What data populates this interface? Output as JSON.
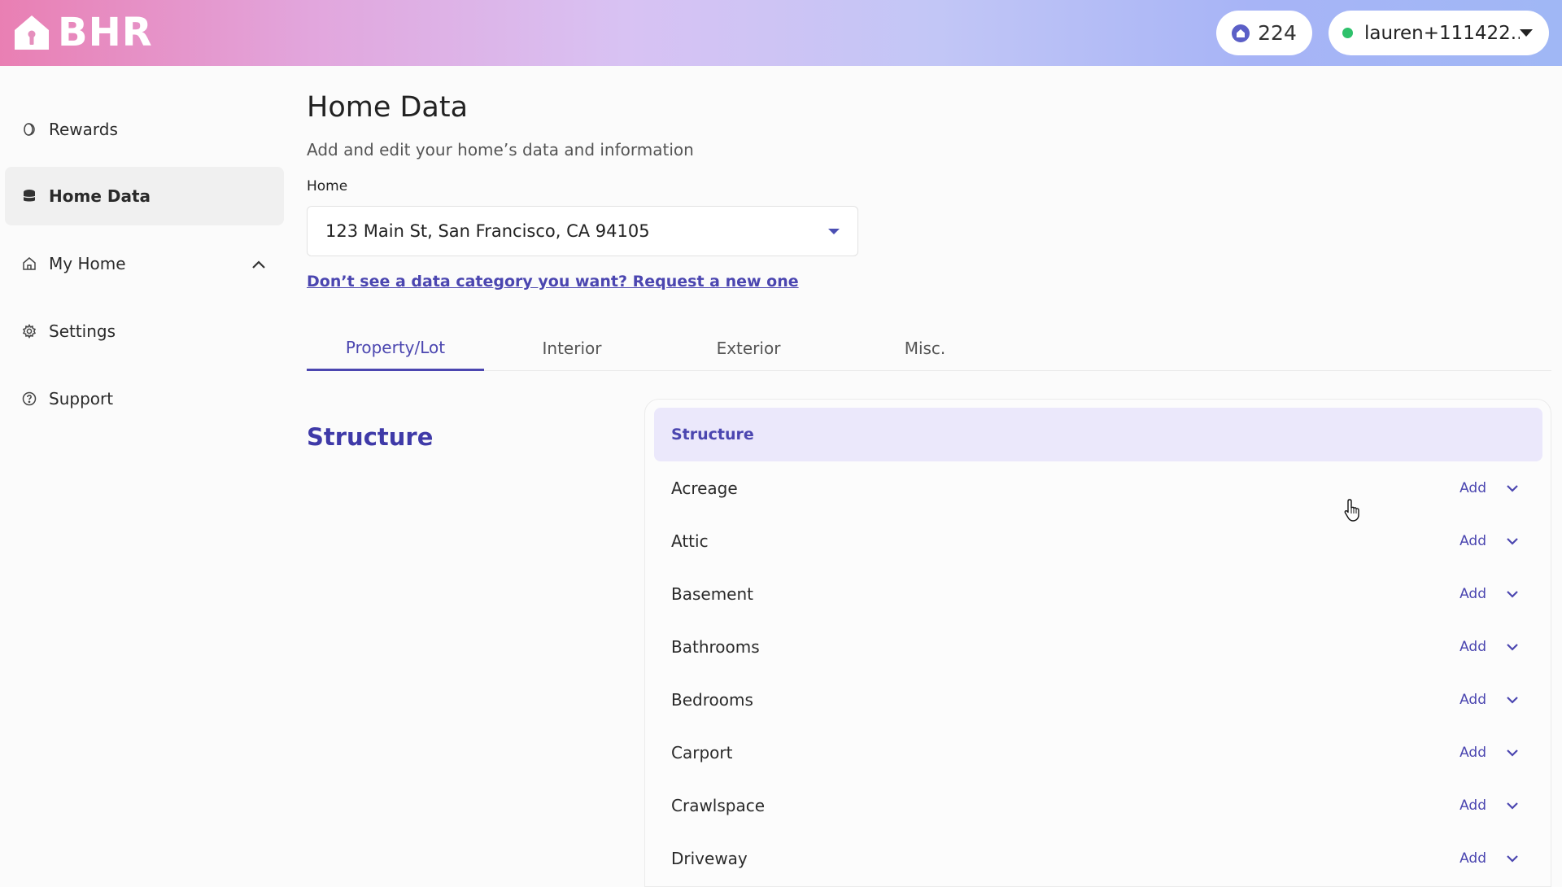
{
  "brand": {
    "name": "BHR"
  },
  "header": {
    "points": "224",
    "user": "lauren+111422..."
  },
  "sidebar": {
    "items": [
      {
        "label": "Rewards",
        "icon": "rewards-icon"
      },
      {
        "label": "Home Data",
        "icon": "database-icon",
        "active": true
      },
      {
        "label": "My Home",
        "icon": "house-icon",
        "expandable": true
      },
      {
        "label": "Settings",
        "icon": "gear-icon"
      },
      {
        "label": "Support",
        "icon": "help-icon"
      }
    ]
  },
  "main": {
    "title": "Home Data",
    "subtitle": "Add and edit your home’s data and information",
    "home_label": "Home",
    "home_value": "123 Main St, San Francisco, CA 94105",
    "request_link": "Don’t see a data category you want? Request a new one",
    "tabs": [
      {
        "label": "Property/Lot",
        "active": true
      },
      {
        "label": "Interior"
      },
      {
        "label": "Exterior"
      },
      {
        "label": "Misc."
      }
    ],
    "section_title": "Structure",
    "panel": {
      "header": "Structure",
      "add_label": "Add",
      "rows": [
        "Acreage",
        "Attic",
        "Basement",
        "Bathrooms",
        "Bedrooms",
        "Carport",
        "Crawlspace",
        "Driveway"
      ]
    }
  },
  "colors": {
    "accent": "#4b46b0",
    "panel_header_bg": "#ebe8fb",
    "status_online": "#2ec16b"
  }
}
